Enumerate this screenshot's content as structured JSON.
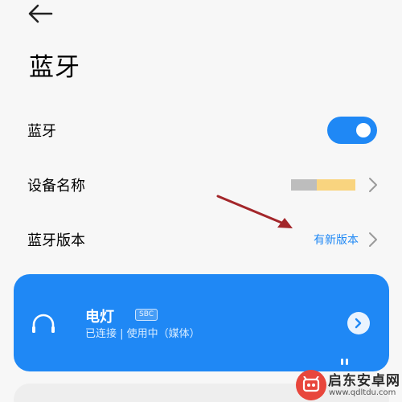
{
  "header": {
    "back_icon": "back-arrow-icon",
    "title": "蓝牙"
  },
  "settings": {
    "bluetooth_label": "蓝牙",
    "bluetooth_enabled": true,
    "device_name_label": "设备名称",
    "bluetooth_version_label": "蓝牙版本",
    "bluetooth_version_value": "有新版本"
  },
  "connected_device": {
    "name": "电灯",
    "codec_badge": "SBC",
    "status": "已连接 | 使用中（媒体）",
    "icon": "headphones-icon"
  },
  "watermark": {
    "title": "启东安卓网",
    "url": "www.qdltdu.com"
  },
  "colors": {
    "accent": "#1f88f5",
    "annotation_arrow": "#a3262a",
    "background": "#f7f7f7"
  }
}
